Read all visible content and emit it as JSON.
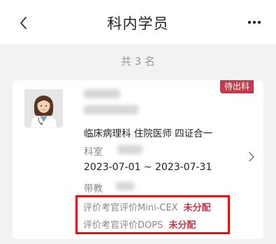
{
  "header": {
    "title": "科内学员",
    "back_icon": "chevron-left-icon",
    "more_icon": "more-horizontal-icon"
  },
  "summary": {
    "count_text": "共 3 名"
  },
  "student": {
    "badge": "待出科",
    "avatar_icon": "female-doctor-avatar-icon",
    "department_line": "临床病理科  住院医师  四证合一",
    "dept_label": "科室",
    "date_range": "2023-07-01 ~ 2023-07-31",
    "mentor_label": "带教",
    "evaluations": [
      {
        "label": "评价考官评价Mini-CEX",
        "status": "未分配"
      },
      {
        "label": "评价考官评价DOPS",
        "status": "未分配"
      }
    ]
  },
  "colors": {
    "accent": "#c8384b",
    "highlight_border": "#e01010",
    "background": "#f2f2f2"
  }
}
